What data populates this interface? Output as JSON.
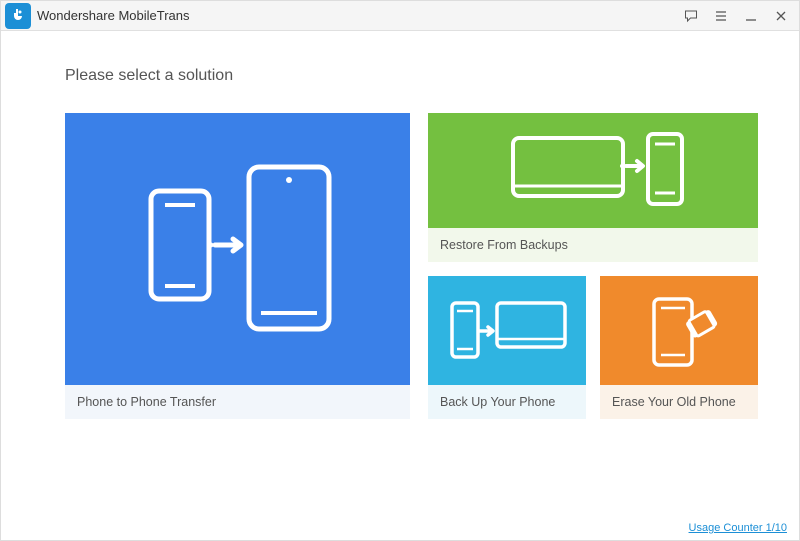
{
  "app": {
    "brand": "Wondershare",
    "product": "MobileTrans"
  },
  "heading": "Please select a solution",
  "tiles": {
    "p2p": {
      "label": "Phone to Phone Transfer"
    },
    "restore": {
      "label": "Restore From Backups"
    },
    "backup": {
      "label": "Back Up Your Phone"
    },
    "erase": {
      "label": "Erase Your Old Phone"
    }
  },
  "footer": {
    "usage_counter": "Usage Counter 1/10"
  },
  "colors": {
    "p2p": "#3a80e8",
    "restore": "#74c040",
    "backup": "#2fb4e1",
    "erase": "#f08a2c",
    "brand": "#1c8fd6"
  }
}
